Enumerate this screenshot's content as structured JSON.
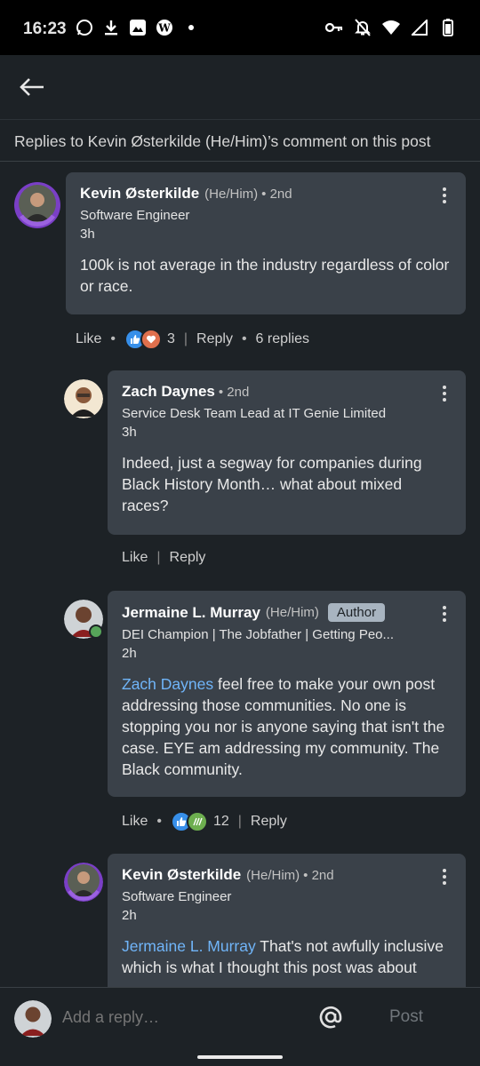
{
  "status_bar": {
    "time": "16:23",
    "left_icons": [
      "whatsapp-icon",
      "download-icon",
      "photo-icon",
      "w-icon",
      "dot-icon"
    ],
    "right_icons": [
      "key-icon",
      "bell-off-icon",
      "wifi-icon",
      "signal-icon",
      "battery-icon"
    ]
  },
  "header": {
    "back_icon": "arrow-left-icon",
    "subheader": "Replies to Kevin Østerkilde (He/Him)’s comment on this post"
  },
  "comments": [
    {
      "name": "Kevin Østerkilde",
      "pronouns": "(He/Him)",
      "degree": "• 2nd",
      "headline": "Software Engineer",
      "time": "3h",
      "body": "100k is not average in the industry regardless of color or race.",
      "actions": {
        "like": "Like",
        "reaction_count": "3",
        "reply": "Reply",
        "replies": "6 replies"
      }
    },
    {
      "name": "Zach Daynes",
      "degree": "• 2nd",
      "headline": "Service Desk Team Lead at IT Genie Limited",
      "time": "3h",
      "body": "Indeed, just a segway for companies during Black History Month… what about mixed races?",
      "actions": {
        "like": "Like",
        "reply": "Reply"
      }
    },
    {
      "name": "Jermaine L. Murray",
      "pronouns": "(He/Him)",
      "badge": "Author",
      "headline": "DEI Champion | The Jobfather | Getting Peo...",
      "time": "2h",
      "mention": "Zach Daynes",
      "body": " feel free to make your own post addressing those communities. No one is stopping you nor is anyone saying that isn't the case. EYE am addressing my community. The Black community.",
      "actions": {
        "like": "Like",
        "reaction_count": "12",
        "reply": "Reply"
      }
    },
    {
      "name": "Kevin Østerkilde",
      "pronouns": "(He/Him)",
      "degree": "• 2nd",
      "headline": "Software Engineer",
      "time": "2h",
      "mention": "Jermaine L. Murray",
      "body": " That's not awfully inclusive which is what I thought this post was about"
    }
  ],
  "composer": {
    "placeholder": "Add a reply…",
    "at_icon": "at-sign-icon",
    "post_label": "Post"
  },
  "colors": {
    "background": "#1d2226",
    "bubble": "#3a4149",
    "mention": "#70b5f9",
    "badge": "#a8b4c0"
  }
}
